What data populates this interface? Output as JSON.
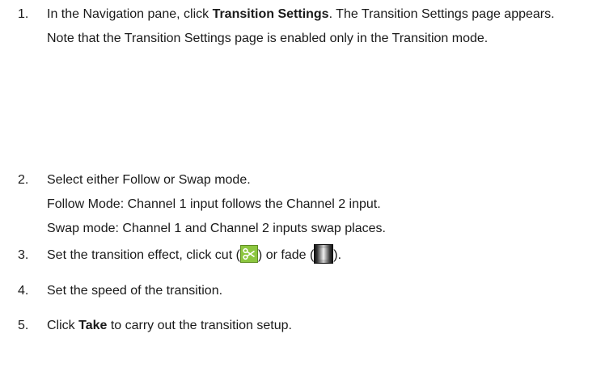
{
  "steps": [
    {
      "number": "1.",
      "text_before": "In the Navigation pane, click ",
      "bold": "Transition Settings",
      "text_after": ". The Transition Settings page appears.",
      "note": "Note that the Transition Settings page is enabled only in the Transition mode."
    },
    {
      "number": "2.",
      "text": "Select either Follow or Swap mode.",
      "follow": "Follow Mode: Channel 1 input follows the Channel 2 input.",
      "swap": "Swap mode: Channel 1 and Channel 2 inputs swap places."
    },
    {
      "number": "3.",
      "text_before": "Set the transition effect, click cut (",
      "text_middle": ") or fade (",
      "text_after": ").",
      "cut_icon": "scissors-icon",
      "fade_icon": "fade-icon"
    },
    {
      "number": "4.",
      "text": "Set the speed of the transition."
    },
    {
      "number": "5.",
      "text_before": "Click ",
      "bold": "Take",
      "text_after": " to carry out the transition setup."
    }
  ]
}
